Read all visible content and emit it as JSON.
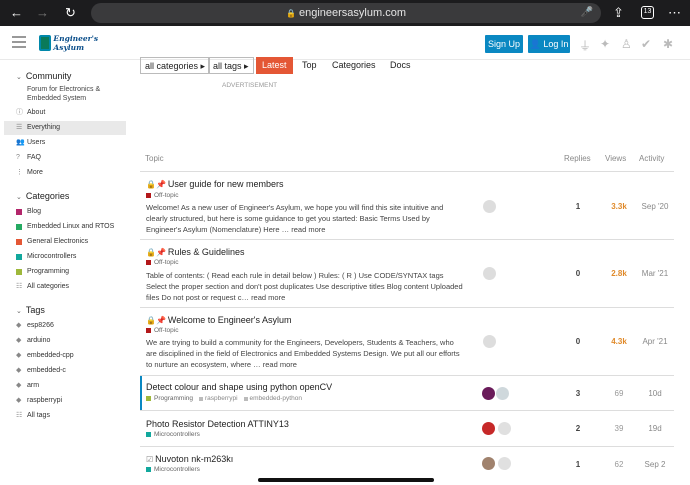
{
  "browser": {
    "url": "engineersasylum.com",
    "tab_count": "13"
  },
  "header": {
    "logo_text": "Engineer's Asylum",
    "signup_label": "Sign Up",
    "login_label": "Log In"
  },
  "sidebar": {
    "community": {
      "heading": "Community",
      "subtitle": "Forum for Electronics & Embedded System",
      "items": [
        {
          "label": "About"
        },
        {
          "label": "Everything"
        },
        {
          "label": "Users"
        },
        {
          "label": "FAQ"
        },
        {
          "label": "More"
        }
      ]
    },
    "categories": {
      "heading": "Categories",
      "items": [
        {
          "label": "Blog",
          "color": "#b3266b"
        },
        {
          "label": "Embedded Linux and RTOS",
          "color": "#25aa62"
        },
        {
          "label": "General Electronics",
          "color": "#e45735"
        },
        {
          "label": "Microcontrollers",
          "color": "#12a89d"
        },
        {
          "label": "Programming",
          "color": "#9eb83b"
        },
        {
          "label": "All categories"
        }
      ]
    },
    "tags": {
      "heading": "Tags",
      "items": [
        {
          "label": "esp8266"
        },
        {
          "label": "arduino"
        },
        {
          "label": "embedded-cpp"
        },
        {
          "label": "embedded-c"
        },
        {
          "label": "arm"
        },
        {
          "label": "raspberrypi"
        },
        {
          "label": "All tags"
        }
      ]
    }
  },
  "nav": {
    "categories_dd": "all categories",
    "tags_dd": "all tags",
    "latest": "Latest",
    "top": "Top",
    "categories": "Categories",
    "docs": "Docs"
  },
  "advertisement": "ADVERTISEMENT",
  "table": {
    "columns": {
      "topic": "Topic",
      "replies": "Replies",
      "views": "Views",
      "activity": "Activity"
    }
  },
  "topics": [
    {
      "title": "User guide for new members",
      "category": "Off-topic",
      "cat_color": "#b3181a",
      "excerpt": "Welcome! As a new user of Engineer's Asylum, we hope you will find this site intuitive and clearly structured, but here is some guidance to get you started: Basic Terms Used by Engineer's Asylum (Nomenclature) Here …",
      "read_more": "read more",
      "replies": "1",
      "views": "3.3k",
      "activity": "Sep '20"
    },
    {
      "title": "Rules & Guidelines",
      "category": "Off-topic",
      "cat_color": "#b3181a",
      "excerpt": "Table of contents: ( Read each rule in detail below ) Rules: ( R ) Use CODE/SYNTAX tags Select the proper section and don't post duplicates Use descriptive titles Blog content Uploaded files Do not post or request c…",
      "read_more": "read more",
      "replies": "0",
      "views": "2.8k",
      "activity": "Mar '21"
    },
    {
      "title": "Welcome to Engineer's Asylum",
      "category": "Off-topic",
      "cat_color": "#b3181a",
      "excerpt": "We are trying to build a community for the Engineers, Developers, Students & Teachers, who are disciplined in the field of Electronics and Embedded Systems Design. We put all our efforts to nurture an ecosystem, where …",
      "read_more": "read more",
      "replies": "0",
      "views": "4.3k",
      "activity": "Apr '21"
    },
    {
      "title": "Detect colour and shape using python openCV",
      "category": "Programming",
      "cat_color": "#9eb83b",
      "tags": [
        "raspberrypi",
        "embedded-python"
      ],
      "replies": "3",
      "views": "69",
      "activity": "10d"
    },
    {
      "title": "Photo Resistor Detection ATTINY13",
      "category": "Microcontrollers",
      "cat_color": "#12a89d",
      "replies": "2",
      "views": "39",
      "activity": "19d"
    },
    {
      "title": "Nuvoton nk-m263kı",
      "category": "Microcontrollers",
      "cat_color": "#12a89d",
      "replies": "1",
      "views": "62",
      "activity": "Sep 2"
    }
  ]
}
